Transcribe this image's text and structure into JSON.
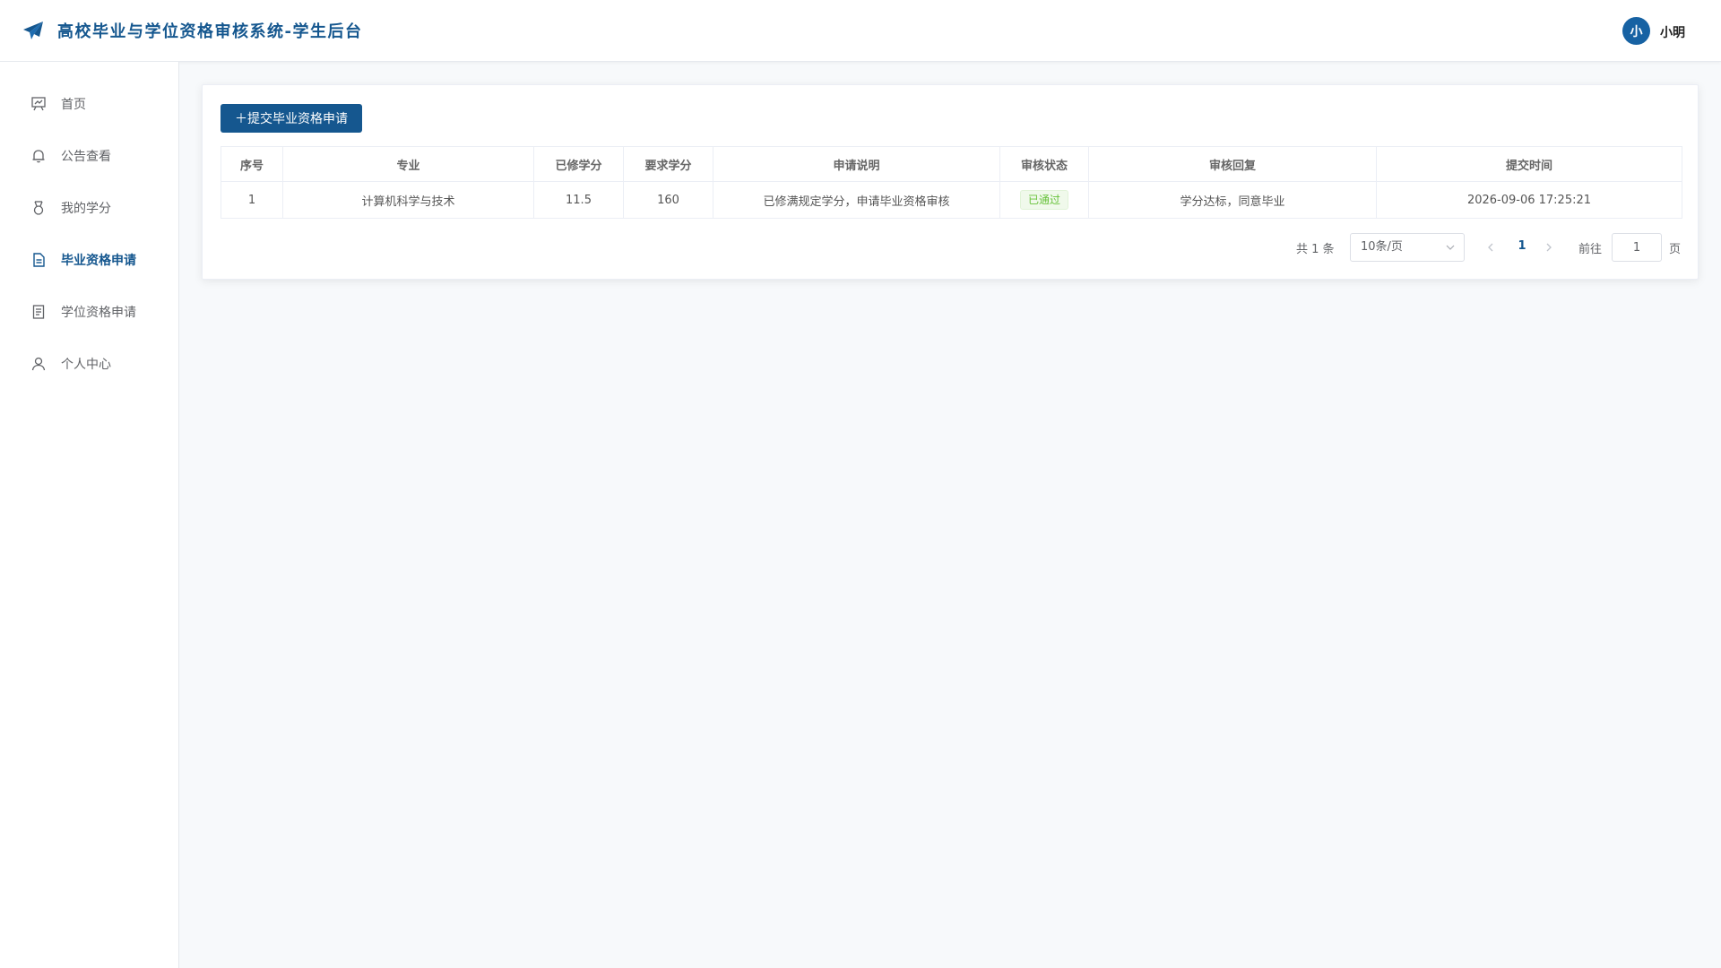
{
  "header": {
    "title": "高校毕业与学位资格审核系统-学生后台",
    "user_avatar_text": "小",
    "user_name": "小明"
  },
  "sidebar": {
    "items": [
      {
        "label": "首页",
        "icon": "presentation-icon"
      },
      {
        "label": "公告查看",
        "icon": "bell-icon"
      },
      {
        "label": "我的学分",
        "icon": "medal-icon"
      },
      {
        "label": "毕业资格申请",
        "icon": "document-icon",
        "active": true
      },
      {
        "label": "学位资格申请",
        "icon": "document-list-icon"
      },
      {
        "label": "个人中心",
        "icon": "user-icon"
      }
    ]
  },
  "main": {
    "submit_button_label": "＋提交毕业资格申请",
    "table": {
      "columns": [
        "序号",
        "专业",
        "已修学分",
        "要求学分",
        "申请说明",
        "审核状态",
        "审核回复",
        "提交时间"
      ],
      "rows": [
        {
          "index": "1",
          "major": "计算机科学与技术",
          "earned_credits": "11.5",
          "required_credits": "160",
          "description": "已修满规定学分，申请毕业资格审核",
          "status": "已通过",
          "reply": "学分达标，同意毕业",
          "submitted_at": "2026-09-06 17:25:21"
        }
      ]
    },
    "pagination": {
      "total_text": "共 1 条",
      "page_size": "10条/页",
      "current_page": "1",
      "goto_label": "前往",
      "goto_value": "1",
      "page_unit": "页"
    }
  },
  "colors": {
    "brand": "#15578f",
    "status_approved": "#67c23a"
  }
}
